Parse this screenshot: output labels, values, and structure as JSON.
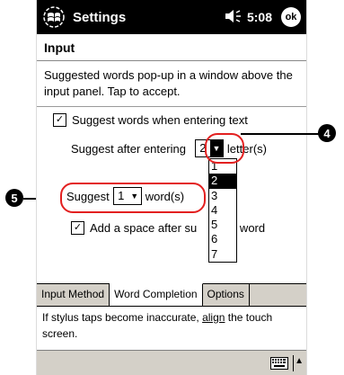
{
  "titlebar": {
    "title": "Settings",
    "time": "5:08",
    "ok_label": "ok",
    "speaker_icon": "speaker-icon"
  },
  "page": {
    "heading": "Input",
    "description": "Suggested words pop-up in a window above the input panel.  Tap to accept."
  },
  "options": {
    "suggest_words_label": "Suggest words when entering text",
    "suggest_words_checked": true,
    "suggest_after_label": "Suggest after entering",
    "suggest_after_value": "2",
    "letters_label": "letter(s)",
    "suggest_label": "Suggest",
    "suggest_count_value": "1",
    "words_label": "word(s)",
    "add_space_label_left": "Add a space after su",
    "add_space_label_right": "ted word",
    "add_space_checked": true
  },
  "letters_dropdown": {
    "options": [
      "1",
      "2",
      "3",
      "4",
      "5",
      "6",
      "7"
    ],
    "selected": "2"
  },
  "tabs": [
    {
      "label": "Input Method",
      "active": false
    },
    {
      "label": "Word Completion",
      "active": true
    },
    {
      "label": "Options",
      "active": false
    }
  ],
  "footer": {
    "text_before": "If stylus taps become inaccurate, ",
    "link_text": "align",
    "text_after": " the touch screen."
  },
  "callouts": {
    "badge_4": "4",
    "badge_5": "5",
    "color": "#e32020"
  }
}
